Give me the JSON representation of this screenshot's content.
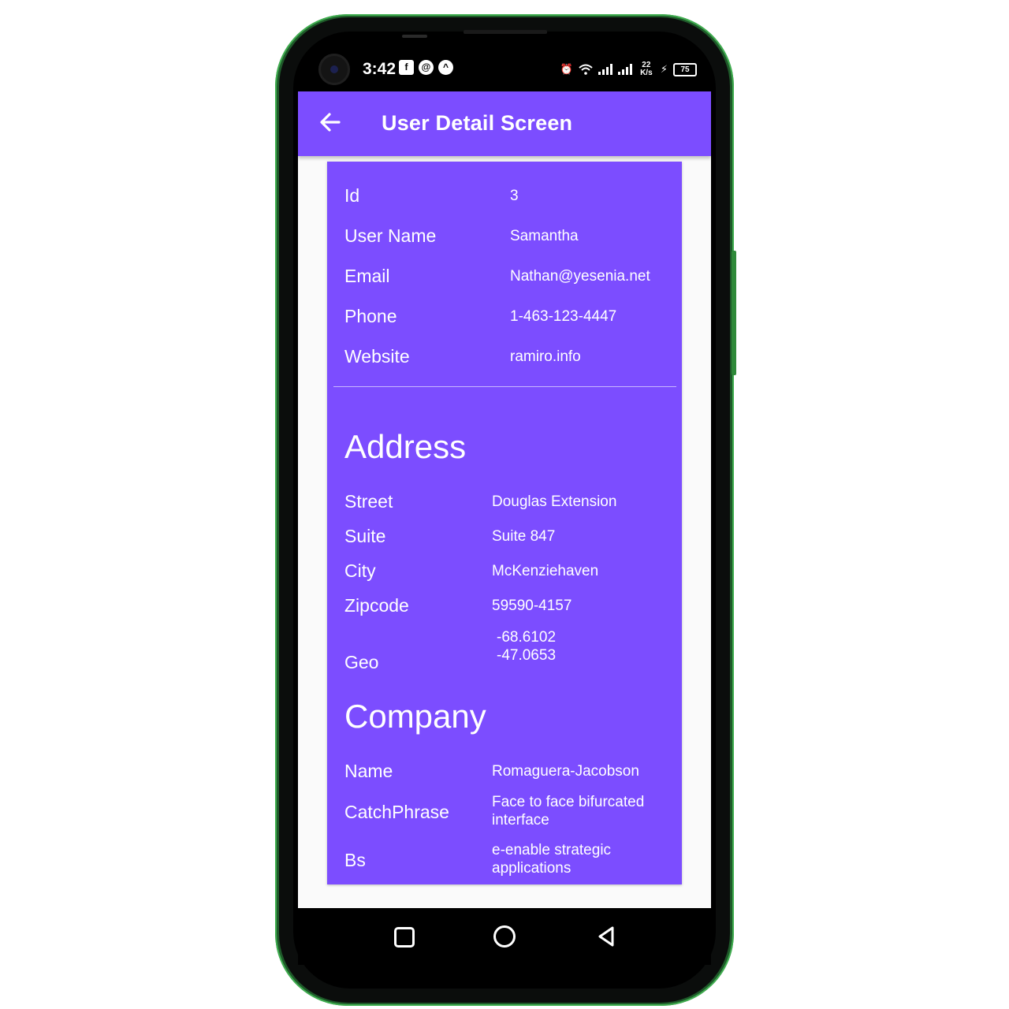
{
  "status_bar": {
    "time": "3:42",
    "left_icons": [
      "facebook-icon",
      "notification-icon",
      "app-icon"
    ],
    "network_speed": "22 K/s",
    "battery": "75"
  },
  "app_bar": {
    "title": "User Detail Screen",
    "back_icon": "arrow-left-icon",
    "color": "#7c4dff"
  },
  "user": {
    "fields": [
      {
        "label": "Id",
        "value": "3"
      },
      {
        "label": "User Name",
        "value": "Samantha"
      },
      {
        "label": "Email",
        "value": "Nathan@yesenia.net"
      },
      {
        "label": "Phone",
        "value": "1-463-123-4447"
      },
      {
        "label": "Website",
        "value": "ramiro.info"
      }
    ]
  },
  "address": {
    "heading": "Address",
    "fields": [
      {
        "label": "Street",
        "value": "Douglas Extension"
      },
      {
        "label": "Suite",
        "value": "Suite 847"
      },
      {
        "label": "City",
        "value": "McKenziehaven"
      },
      {
        "label": "Zipcode",
        "value": "59590-4157"
      }
    ],
    "geo": {
      "label": "Geo",
      "lat": "-68.6102",
      "lng": "-47.0653"
    }
  },
  "company": {
    "heading": "Company",
    "fields": [
      {
        "label": "Name",
        "value_lines": [
          "Romaguera-Jacobson"
        ]
      },
      {
        "label": "CatchPhrase",
        "value_lines": [
          "Face to face bifurcated",
          "interface"
        ]
      },
      {
        "label": "Bs",
        "value_lines": [
          "e-enable strategic",
          "applications"
        ]
      }
    ]
  },
  "nav_bar": {
    "buttons": [
      "recent-apps-icon",
      "home-icon",
      "back-triangle-icon"
    ]
  }
}
